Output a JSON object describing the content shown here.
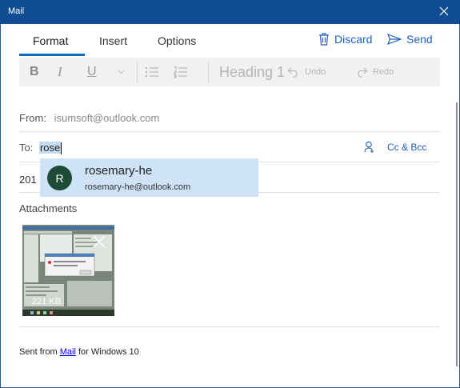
{
  "window": {
    "title": "Mail"
  },
  "tabs": [
    {
      "label": "Format",
      "active": true
    },
    {
      "label": "Insert",
      "active": false
    },
    {
      "label": "Options",
      "active": false
    }
  ],
  "actions": {
    "discard_label": "Discard",
    "send_label": "Send"
  },
  "toolbar": {
    "bold": "B",
    "italic": "I",
    "underline": "U",
    "heading": "Heading 1",
    "undo": "Undo",
    "redo": "Redo"
  },
  "from": {
    "label": "From:",
    "value": "isumsoft@outlook.com"
  },
  "to": {
    "label": "To:",
    "value": "rose",
    "cc_bcc": "Cc & Bcc"
  },
  "suggestion": {
    "initial": "R",
    "name": "rosemary-he",
    "email": "rosemary-he@outlook.com"
  },
  "subject": {
    "value": "201"
  },
  "attachments": {
    "label": "Attachments",
    "items": [
      {
        "size": "221 KB"
      }
    ]
  },
  "signature": {
    "prefix": "Sent from ",
    "link": "Mail",
    "suffix": " for Windows 10"
  },
  "colors": {
    "titlebar": "#0f4c92",
    "accent": "#0f6cbd",
    "link": "#1e5fbf",
    "avatar": "#1f4a37"
  }
}
